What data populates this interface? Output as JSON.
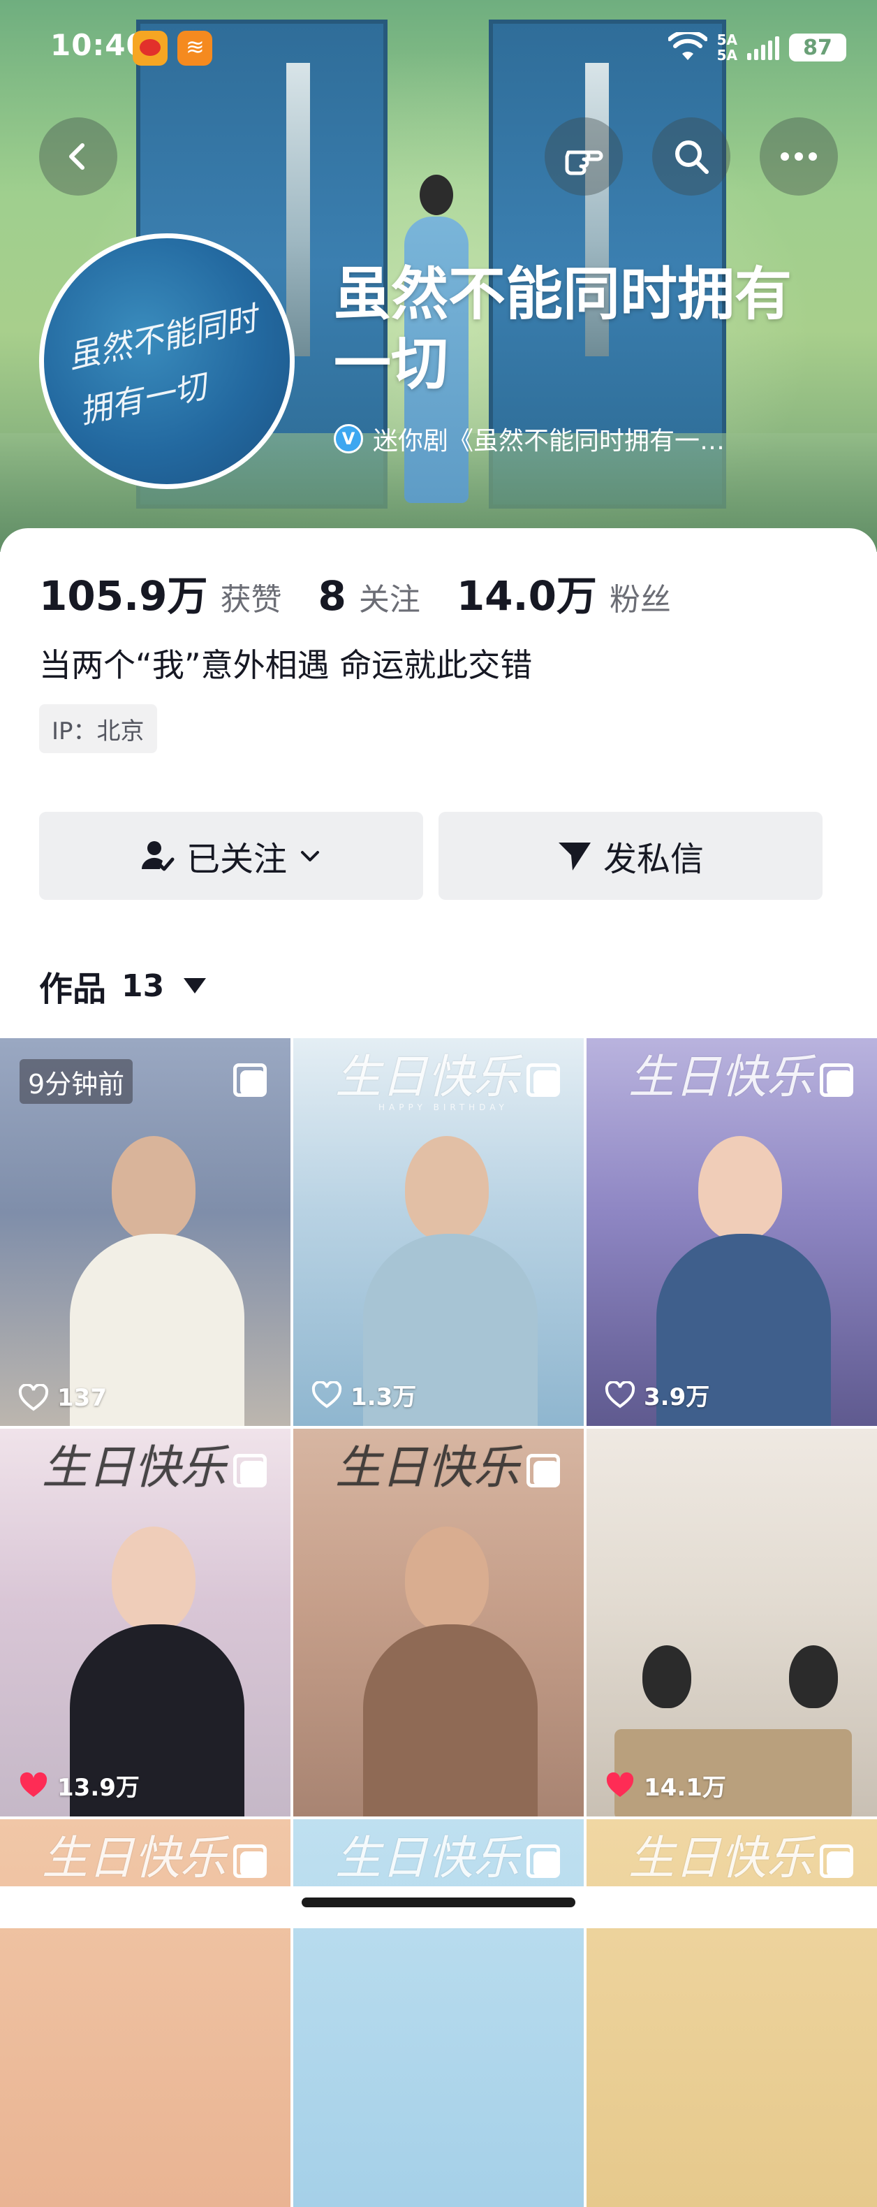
{
  "status_bar": {
    "time": "10:40",
    "network": "5A",
    "network2": "5A",
    "battery": "87"
  },
  "nav": {
    "back_icon": "chevron-left-icon",
    "hand_icon": "hand-pointer-icon",
    "search_icon": "search-icon",
    "more_icon": "more-horizontal-icon"
  },
  "profile": {
    "avatar_text": "虽然不能同时拥有一切",
    "name": "虽然不能同时拥有一切",
    "verified_text": "迷你剧《虽然不能同时拥有一…",
    "verified_badge": "V"
  },
  "stats": [
    {
      "value": "105.9万",
      "label": "获赞"
    },
    {
      "value": "8",
      "label": "关注"
    },
    {
      "value": "14.0万",
      "label": "粉丝"
    }
  ],
  "bio": "当两个“我”意外相遇 命运就此交错",
  "ip_location": "IP：北京",
  "buttons": {
    "follow": "已关注",
    "message": "发私信"
  },
  "works": {
    "label": "作品",
    "count": "13"
  },
  "grid": [
    {
      "title": "",
      "badge": "9分钟前",
      "likes": "137",
      "liked": false
    },
    {
      "title": "生日快乐",
      "badge": "",
      "likes": "1.3万",
      "liked": false
    },
    {
      "title": "生日快乐",
      "badge": "",
      "likes": "3.9万",
      "liked": false
    },
    {
      "title": "生日快乐",
      "badge": "",
      "likes": "13.9万",
      "liked": true
    },
    {
      "title": "生日快乐",
      "badge": "",
      "likes": "",
      "liked": false
    },
    {
      "title": "",
      "badge": "",
      "likes": "14.1万",
      "liked": true
    },
    {
      "title": "生日快乐",
      "badge": "",
      "likes": "",
      "liked": false
    },
    {
      "title": "生日快乐",
      "badge": "",
      "likes": "",
      "liked": false
    },
    {
      "title": "生日快乐",
      "badge": "",
      "likes": "",
      "liked": false
    }
  ],
  "colors": {
    "accent_like": "#fe2c55",
    "text_primary": "#161823",
    "button_bg": "#eeeff1"
  }
}
